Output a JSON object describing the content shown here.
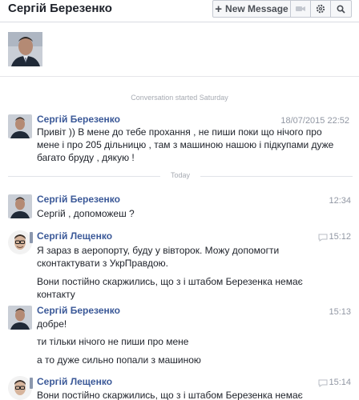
{
  "header": {
    "title": "Сергій Березенко",
    "new_message_label": "New Message",
    "icons": [
      "plus-icon",
      "video-icon",
      "gear-icon",
      "search-icon"
    ]
  },
  "conversation": {
    "started_note": "Conversation started Saturday",
    "today_label": "Today"
  },
  "messages": [
    {
      "sender": "Сергій Березенко",
      "time": "18/07/2015 22:52",
      "text": "Привіт )) В мене до тебе прохання , не пиши поки  що нічого про мене і про 205 дільницю , там з машиною нашою і підкупами дуже багато бруду , дякую !"
    },
    {
      "sender": "Сергій Березенко",
      "time": "12:34",
      "text": "Сергій , допоможеш ?"
    },
    {
      "sender": "Сергій Лещенко",
      "time": "15:12",
      "text": "Я зараз в аеропорту, буду у вівторок. Можу допомогти сконтактувати з УкрПравдою.",
      "text2": "Вони постійно скаржились, що з  і штабом Березенка немає контакту"
    },
    {
      "sender": "Сергій Березенко",
      "time": "15:13",
      "text": "добре!",
      "text2": "ти тільки нічого не пиши про мене",
      "text3": "а то дуже сильно попали з машиною"
    },
    {
      "sender": "Сергій Лещенко",
      "time": "15:14",
      "text": "Вони постійно скаржились, що з  і штабом Березенка немає"
    }
  ],
  "colors": {
    "link_blue": "#3b5998",
    "timestamp_gray": "#9197a3",
    "separator": "#e1e3e8"
  }
}
